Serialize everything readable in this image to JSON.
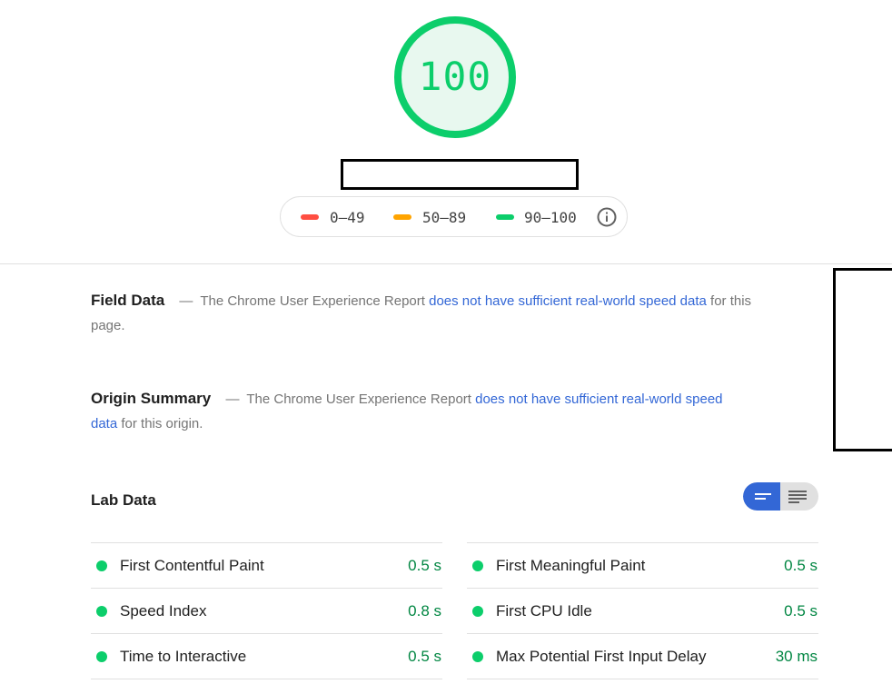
{
  "score": {
    "value": "100",
    "color": "#0cce6b",
    "fill": "#e8f8ef"
  },
  "legend": {
    "items": [
      {
        "label": "0–49",
        "color": "#ff4e42"
      },
      {
        "label": "50–89",
        "color": "#ffa400"
      },
      {
        "label": "90–100",
        "color": "#0cce6b"
      }
    ],
    "info_icon": "info-icon"
  },
  "field_data": {
    "title": "Field Data",
    "dash": "—",
    "text_before": "The Chrome User Experience Report",
    "link": "does not have sufficient real-world speed data",
    "text_after": "for this page."
  },
  "origin_summary": {
    "title": "Origin Summary",
    "dash": "—",
    "text_before": "The Chrome User Experience Report",
    "link": "does not have sufficient real-world speed data",
    "text_after": "for this origin."
  },
  "lab_data": {
    "title": "Lab Data",
    "view_toggle": {
      "selected": "compact-view",
      "options": [
        "compact-view-icon",
        "detailed-view-icon"
      ],
      "active_color": "#3367d6"
    },
    "metrics_left": [
      {
        "name": "First Contentful Paint",
        "value": "0.5 s"
      },
      {
        "name": "Speed Index",
        "value": "0.8 s"
      },
      {
        "name": "Time to Interactive",
        "value": "0.5 s"
      }
    ],
    "metrics_right": [
      {
        "name": "First Meaningful Paint",
        "value": "0.5 s"
      },
      {
        "name": "First CPU Idle",
        "value": "0.5 s"
      },
      {
        "name": "Max Potential First Input Delay",
        "value": "30 ms"
      }
    ],
    "pass_color": "#0cce6b",
    "value_color": "#018642"
  }
}
